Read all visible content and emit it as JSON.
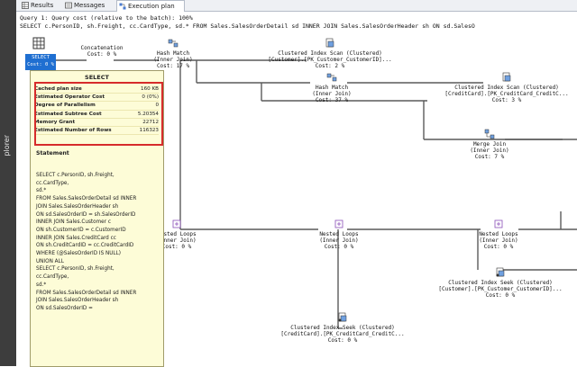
{
  "left_panel": {
    "label": "plorer"
  },
  "tabs": [
    {
      "label": "Results",
      "icon": "grid-icon"
    },
    {
      "label": "Messages",
      "icon": "message-icon"
    },
    {
      "label": "Execution plan",
      "icon": "execution-plan-icon"
    }
  ],
  "query": {
    "line1": "Query 1: Query cost (relative to the batch): 100%",
    "line2": "SELECT c.PersonID, sh.Freight, cc.CardType, sd.* FROM Sales.SalesOrderDetail sd INNER JOIN Sales.SalesOrderHeader sh ON sd.SalesO"
  },
  "select_node": {
    "label": "SELECT",
    "cost": "Cost: 0 %"
  },
  "nodes": {
    "concatenation": {
      "name": "Concatenation",
      "cost": "Cost: 0 %"
    },
    "hash_match_1": {
      "name": "Hash Match",
      "type": "(Inner Join)",
      "cost": "Cost: 17 %"
    },
    "ci_scan_customer": {
      "name": "Clustered Index Scan (Clustered)",
      "object": "[Customer].[PK_Customer_CustomerID]...",
      "cost": "Cost: 2 %"
    },
    "hash_match_2": {
      "name": "Hash Match",
      "type": "(Inner Join)",
      "cost": "Cost: 37 %"
    },
    "ci_scan_creditcard": {
      "name": "Clustered Index Scan (Clustered)",
      "object": "[CreditCard].[PK_CreditCard_CreditC...",
      "cost": "Cost: 3 %"
    },
    "merge_join": {
      "name": "Merge Join",
      "type": "(Inner Join)",
      "cost": "Cost: 7 %"
    },
    "nested_loops_1": {
      "name": "Nested Loops",
      "type": "(Inner Join)",
      "cost": "Cost: 0 %"
    },
    "nested_loops_2": {
      "name": "Nested Loops",
      "type": "(Inner Join)",
      "cost": "Cost: 0 %"
    },
    "nested_loops_3": {
      "name": "Nested Loops",
      "type": "(Inner Join)",
      "cost": "Cost: 0 %"
    },
    "ci_seek_customer": {
      "name": "Clustered Index Seek (Clustered)",
      "object": "[Customer].[PK_Customer_CustomerID]...",
      "cost": "Cost: 0 %"
    },
    "ci_seek_creditcard": {
      "name": "Clustered Index Seek (Clustered)",
      "object": "[CreditCard].[PK_CreditCard_CreditC...",
      "cost": "Cost: 0 %"
    }
  },
  "tooltip": {
    "title": "SELECT",
    "properties": [
      {
        "key": "Cached plan size",
        "value": "160 KB"
      },
      {
        "key": "Estimated Operator Cost",
        "value": "0 (0%)"
      },
      {
        "key": "Degree of Parallelism",
        "value": "0"
      },
      {
        "key": "Estimated Subtree Cost",
        "value": "5.20354"
      },
      {
        "key": "Memory Grant",
        "value": "22712"
      },
      {
        "key": "Estimated Number of Rows",
        "value": "116323"
      }
    ],
    "statement_header": "Statement",
    "statement": "SELECT c.PersonID, sh.Freight,\ncc.CardType,\nsd.*\nFROM Sales.SalesOrderDetail sd INNER\nJOIN Sales.SalesOrderHeader sh\nON sd.SalesOrderID = sh.SalesOrderID\nINNER JOIN Sales.Customer c\nON sh.CustomerID = c.CustomerID\nINNER JOIN Sales.CreditCard cc\nON sh.CreditCardID = cc.CreditCardID\nWHERE (@SalesOrderID IS NULL)\nUNION ALL\nSELECT c.PersonID, sh.Freight,\ncc.CardType,\nsd.*\nFROM Sales.SalesOrderDetail sd INNER\nJOIN Sales.SalesOrderHeader sh\nON sd.SalesOrderID ="
  },
  "colors": {
    "highlight": "#d62b2b",
    "tooltip_bg": "#fdfcd7",
    "selected_node": "#1f6fd1"
  }
}
